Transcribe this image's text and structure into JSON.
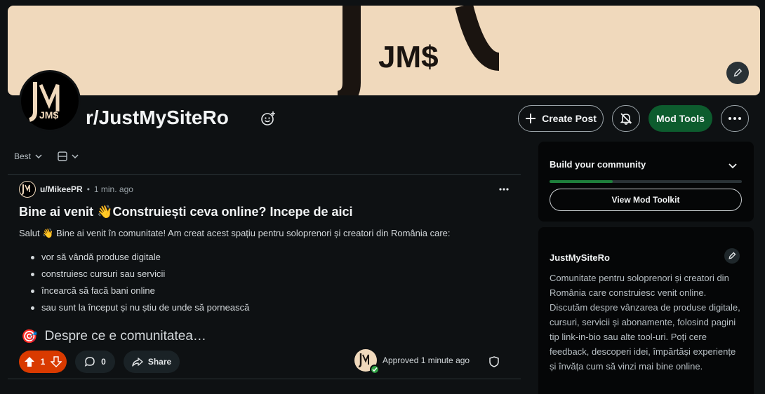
{
  "banner": {
    "logo_text": "JM$"
  },
  "community": {
    "name": "r/JustMySiteRo",
    "avatar_text": "JM$"
  },
  "actions": {
    "create_post": "Create Post",
    "mod_tools": "Mod Tools"
  },
  "sort": {
    "label": "Best"
  },
  "post": {
    "author": "u/MikeePR",
    "dot": "•",
    "time": "1 min. ago",
    "title": "Bine ai venit 👋Construiești ceva online? Incepe de aici",
    "intro": "Salut 👋 Bine ai venit în comunitate! Am creat acest spațiu pentru soloprenori și creatori din România care:",
    "bullets": [
      "vor să vândă produse digitale",
      "construiesc cursuri sau servicii",
      "încearcă să facă bani online",
      "sau sunt la început și nu știu de unde să pornească"
    ],
    "heading_emoji": "🎯",
    "heading": "Despre ce e comunitatea…",
    "votes": "1",
    "comments": "0",
    "share": "Share",
    "approved": "Approved 1 minute ago"
  },
  "sidebar": {
    "build_title": "Build your community",
    "build_progress": 0.33,
    "toolkit_button": "View Mod Toolkit",
    "about_title": "JustMySiteRo",
    "about_desc": "Comunitate pentru soloprenori și creatori din România care construiesc venit online. Discutăm despre vânzarea de produse digitale, cursuri, servicii și abonamente, folosind pagini tip link-in-bio sau alte tool-uri. Poți cere feedback, descoperi idei, împărtăși experiențe și învăța cum să vinzi mai bine online."
  },
  "colors": {
    "banner_bg": "#f0d9bc",
    "upvote_active": "#d93a00",
    "mod_tools_bg": "#0d5c2e",
    "progress_fill": "#1e7f3c"
  }
}
